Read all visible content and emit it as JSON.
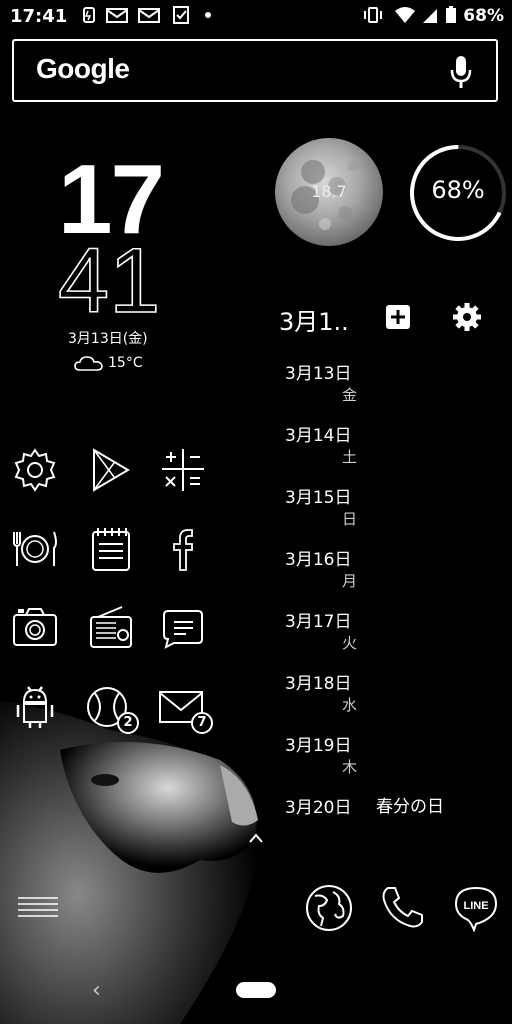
{
  "status": {
    "time": "17:41",
    "battery": "68%",
    "left_icons": [
      "data-saver-icon",
      "mail-icon",
      "mail-icon",
      "tasks-icon",
      "dot-icon"
    ],
    "right_icons": [
      "vibrate-icon",
      "wifi-icon",
      "signal-icon",
      "battery-icon"
    ]
  },
  "search": {
    "logo": "Google"
  },
  "clock": {
    "hour": "17",
    "minute": "41",
    "date": "3月13日(金)"
  },
  "weather": {
    "temp": "15°C",
    "icon": "cloud-icon"
  },
  "moon": {
    "value": "18.7"
  },
  "battery_widget": {
    "label": "68%",
    "level": 0.68
  },
  "calendar": {
    "title": "3月1..",
    "entries": [
      {
        "date": "3月13日",
        "day": "金"
      },
      {
        "date": "3月14日",
        "day": "土"
      },
      {
        "date": "3月15日",
        "day": "日"
      },
      {
        "date": "3月16日",
        "day": "月"
      },
      {
        "date": "3月17日",
        "day": "火"
      },
      {
        "date": "3月18日",
        "day": "水"
      },
      {
        "date": "3月19日",
        "day": "木"
      },
      {
        "date": "3月20日",
        "day": ""
      }
    ],
    "holiday": "春分の日"
  },
  "apps": {
    "row1": [
      "settings-icon",
      "play-store-icon",
      "calculator-icon"
    ],
    "row2": [
      "restaurant-icon",
      "notepad-icon",
      "facebook-icon"
    ],
    "row3": [
      "camera-icon",
      "radio-icon",
      "messages-icon"
    ],
    "row4": [
      "android-icon",
      "tennis-icon",
      "mail-icon"
    ],
    "badges": {
      "tennis": "2",
      "mail": "7"
    }
  },
  "dock": [
    "app-drawer-icon",
    "globe-icon",
    "phone-icon",
    "line-icon"
  ],
  "dock_line_label": "LINE",
  "colors": {
    "background": "#000000",
    "foreground": "#ffffff"
  }
}
